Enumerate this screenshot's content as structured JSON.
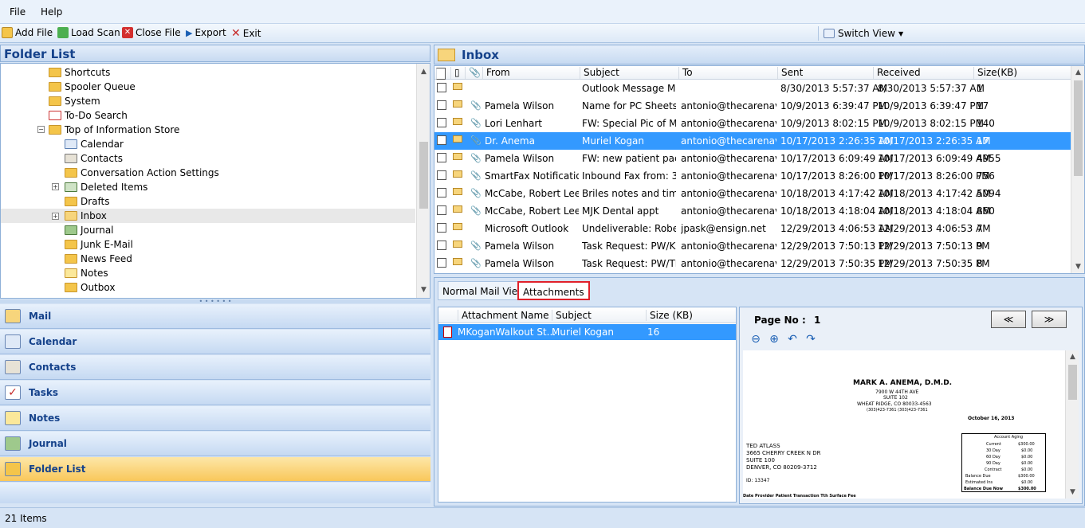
{
  "menu": {
    "file": "File",
    "help": "Help"
  },
  "toolbar": {
    "add_file": "Add File",
    "load_scan": "Load Scan",
    "close_file": "Close File",
    "export": "Export",
    "exit": "Exit",
    "switch_view": "Switch View"
  },
  "folder_list": {
    "title": "Folder List",
    "items": [
      "Shortcuts",
      "Spooler Queue",
      "System",
      "To-Do Search",
      "Top of Information Store",
      "Calendar",
      "Contacts",
      "Conversation Action Settings",
      "Deleted Items",
      "Drafts",
      "Inbox",
      "Journal",
      "Junk E-Mail",
      "News Feed",
      "Notes",
      "Outbox"
    ]
  },
  "nav": {
    "mail": "Mail",
    "calendar": "Calendar",
    "contacts": "Contacts",
    "tasks": "Tasks",
    "notes": "Notes",
    "journal": "Journal",
    "folder_list": "Folder List"
  },
  "status": {
    "items": "21 Items"
  },
  "inbox": {
    "title": "Inbox",
    "columns": {
      "from": "From",
      "subject": "Subject",
      "to": "To",
      "sent": "Sent",
      "received": "Received",
      "size": "Size(KB)"
    },
    "rows": [
      {
        "from": "",
        "subject": "Outlook Message M...",
        "to": "",
        "sent": "8/30/2013 5:57:37 AM",
        "received": "8/30/2013 5:57:37 AM",
        "size": "1"
      },
      {
        "from": "Pamela Wilson",
        "subject": "Name for PC Sheets",
        "to": "antonio@thecarenav...",
        "sent": "10/9/2013 6:39:47 PM",
        "received": "10/9/2013 6:39:47 PM",
        "size": "17"
      },
      {
        "from": "Lori Lenhart",
        "subject": "FW: Special Pic of M...",
        "to": "antonio@thecarenav...",
        "sent": "10/9/2013 8:02:15 PM",
        "received": "10/9/2013 8:02:15 PM",
        "size": "140"
      },
      {
        "from": "Dr. Anema",
        "subject": "Muriel Kogan",
        "to": "antonio@thecarenav...",
        "sent": "10/17/2013 2:26:35 AM",
        "received": "10/17/2013 2:26:35 AM",
        "size": "17"
      },
      {
        "from": "Pamela Wilson",
        "subject": "FW: new patient pac...",
        "to": "antonio@thecarenav...",
        "sent": "10/17/2013 6:09:49 AM",
        "received": "10/17/2013 6:09:49 AM",
        "size": "4955"
      },
      {
        "from": "SmartFax Notifications",
        "subject": "Inbound Fax from: 3...",
        "to": "antonio@thecarenav...",
        "sent": "10/17/2013 8:26:00 PM",
        "received": "10/17/2013 8:26:00 PM",
        "size": "756"
      },
      {
        "from": "McCabe, Robert Lee",
        "subject": "Briles notes and time...",
        "to": "antonio@thecarenav...",
        "sent": "10/18/2013 4:17:42 AM",
        "received": "10/18/2013 4:17:42 AM",
        "size": "5094"
      },
      {
        "from": "McCabe, Robert Lee",
        "subject": "MJK Dental appt",
        "to": "antonio@thecarenav...",
        "sent": "10/18/2013 4:18:04 AM",
        "received": "10/18/2013 4:18:04 AM",
        "size": "860"
      },
      {
        "from": "Microsoft Outlook",
        "subject": "Undeliverable: Robe...",
        "to": "jpask@ensign.net",
        "sent": "12/29/2013 4:06:53 AM",
        "received": "12/29/2013 4:06:53 AM",
        "size": "7"
      },
      {
        "from": "Pamela Wilson",
        "subject": "Task Request: PW/KS ...",
        "to": "antonio@thecarenav...",
        "sent": "12/29/2013 7:50:13 PM",
        "received": "12/29/2013 7:50:13 PM",
        "size": "9"
      },
      {
        "from": "Pamela Wilson",
        "subject": "Task Request: PW/TK ...",
        "to": "antonio@thecarenav...",
        "sent": "12/29/2013 7:50:35 PM",
        "received": "12/29/2013 7:50:35 PM",
        "size": "8"
      }
    ]
  },
  "preview": {
    "tab_normal": "Normal Mail View",
    "tab_attachments": "Attachments",
    "att_columns": {
      "name": "Attachment Name",
      "subject": "Subject",
      "size": "Size (KB)"
    },
    "att_row": {
      "name": "MKoganWalkout St...",
      "subject": "Muriel Kogan",
      "size": "16"
    },
    "page_label": "Page No :",
    "page_value": "1",
    "prev": "≪",
    "next": "≫"
  },
  "document": {
    "doctor": "MARK A. ANEMA, D.M.D.",
    "addr1": "7900 W 44TH AVE",
    "addr2": "SUITE 102",
    "addr3": "WHEAT RIDGE, CO  80033-4563",
    "phones": "(303)423-7361          (303)423-7361",
    "date": "October 16, 2013",
    "patient1": "TED ATLASS",
    "patient2": "3665 CHERRY CREEK N DR",
    "patient3": "SUITE 100",
    "patient4": "DENVER, CO  80209-3712",
    "id": "ID: 13347",
    "aging_title": "Account Aging",
    "aging_rows": [
      {
        "label": "Current",
        "value": "$300.00"
      },
      {
        "label": "30 Day",
        "value": "$0.00"
      },
      {
        "label": "60 Day",
        "value": "$0.00"
      },
      {
        "label": "90 Day",
        "value": "$0.00"
      },
      {
        "label": "Contract",
        "value": "$0.00"
      },
      {
        "label": "Balance Due",
        "value": "$300.00"
      },
      {
        "label": "Estimated Ins",
        "value": "$0.00"
      },
      {
        "label": "Balance Due Now",
        "value": "$300.00"
      }
    ],
    "footer": "Date      Provider                    Patient   Transaction                                              Tth    Surface        Fee"
  }
}
